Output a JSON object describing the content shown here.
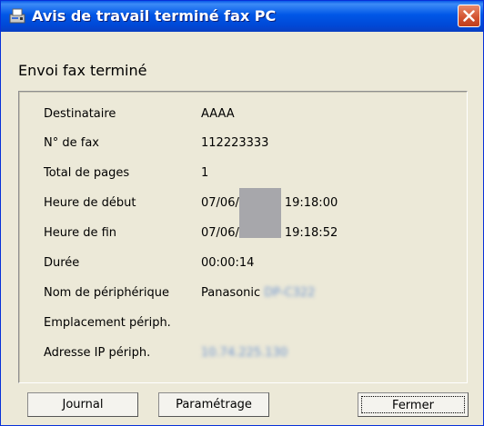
{
  "window": {
    "title": "Avis de travail terminé fax PC"
  },
  "heading": "Envoi fax terminé",
  "fields": [
    {
      "label": "Destinataire",
      "value": "AAAA"
    },
    {
      "label": "N° de fax",
      "value": "112223333"
    },
    {
      "label": "Total de pages",
      "value": "1"
    },
    {
      "label": "Heure de début",
      "value_prefix": "07/06/",
      "value_suffix": "19:18:00"
    },
    {
      "label": "Heure de fin",
      "value_prefix": "07/06/",
      "value_suffix": "19:18:52"
    },
    {
      "label": "Durée",
      "value": "00:00:14"
    },
    {
      "label": "Nom de périphérique",
      "value": "Panasonic",
      "value_blurred": "DP-C322"
    },
    {
      "label": "Emplacement périph.",
      "value": ""
    },
    {
      "label": "Adresse IP périph.",
      "value_blurred": "10.74.225.130"
    }
  ],
  "buttons": {
    "journal": "Journal",
    "parametrage": "Paramétrage",
    "fermer": "Fermer"
  },
  "icons": {
    "app": "fax-printer-icon",
    "close": "close-icon"
  },
  "colors": {
    "titlebar": "#0054e3",
    "close": "#d2522f",
    "background": "#ece9d8"
  }
}
